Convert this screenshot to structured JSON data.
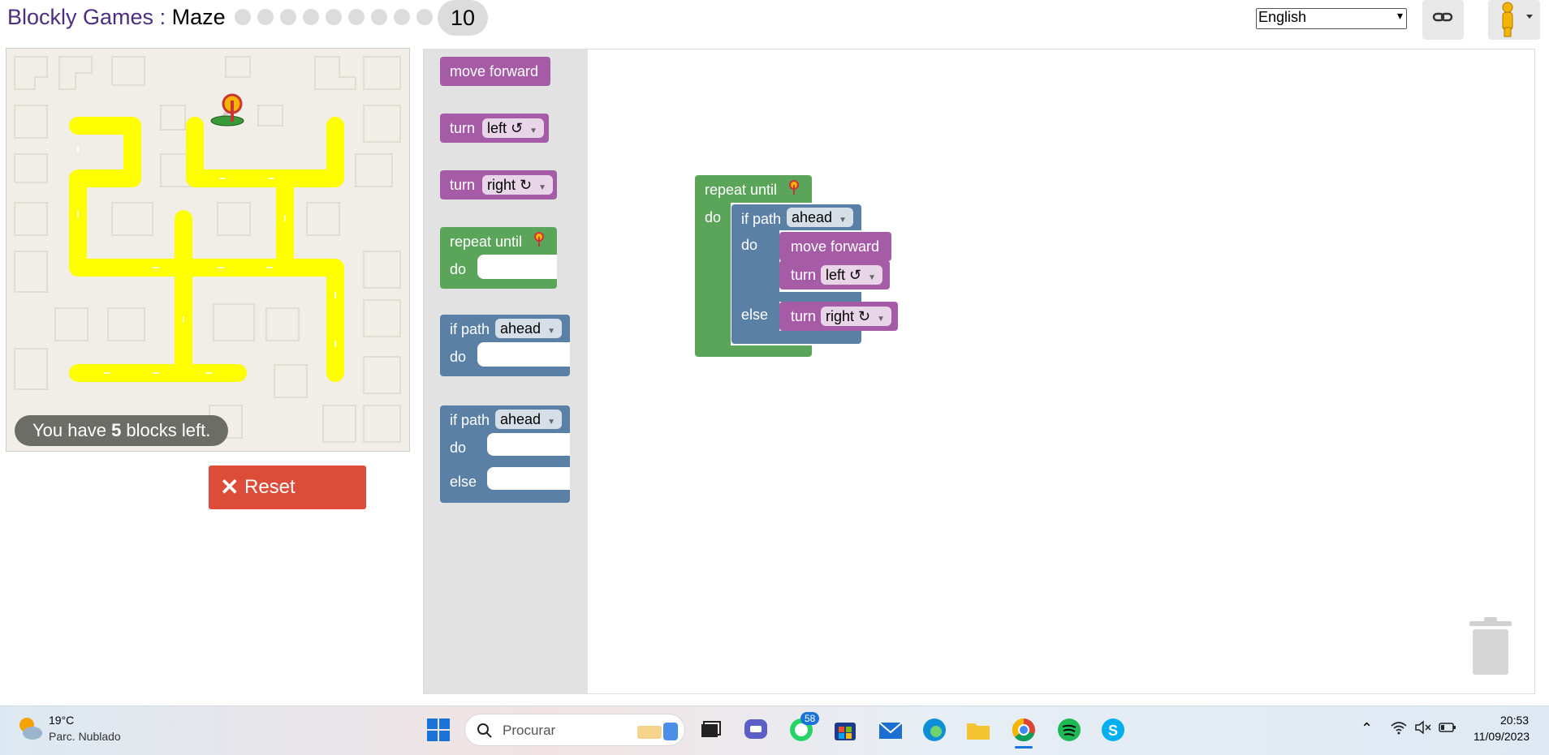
{
  "header": {
    "app_name": "Blockly Games",
    "separator": " : ",
    "game_name": "Maze",
    "current_level": "10",
    "language_selected": "English"
  },
  "maze": {
    "blocks_left_prefix": "You have ",
    "blocks_left_count": "5",
    "blocks_left_suffix": " blocks left.",
    "reset_label": "Reset"
  },
  "toolbox": {
    "move_forward": "move forward",
    "turn": "turn",
    "left": "left ↺",
    "right": "right ↻",
    "repeat_until": "repeat until",
    "do": "do",
    "if_path": "if path",
    "ahead": "ahead",
    "else": "else"
  },
  "program": {
    "repeat_until": "repeat until",
    "do": "do",
    "if_path": "if path",
    "ahead": "ahead",
    "move_forward": "move forward",
    "turn": "turn",
    "left": "left ↺",
    "right": "right ↻",
    "else": "else"
  },
  "taskbar": {
    "weather_temp": "19°C",
    "weather_desc": "Parc. Nublado",
    "search_placeholder": "Procurar",
    "whatsapp_badge": "58",
    "time": "20:53",
    "date": "11/09/2023"
  },
  "colors": {
    "motion_purple": "#a55ba5",
    "loop_green": "#5ba55b",
    "logic_blue": "#5b80a5",
    "path_yellow": "#ffff00",
    "reset_red": "#dd4b39"
  }
}
